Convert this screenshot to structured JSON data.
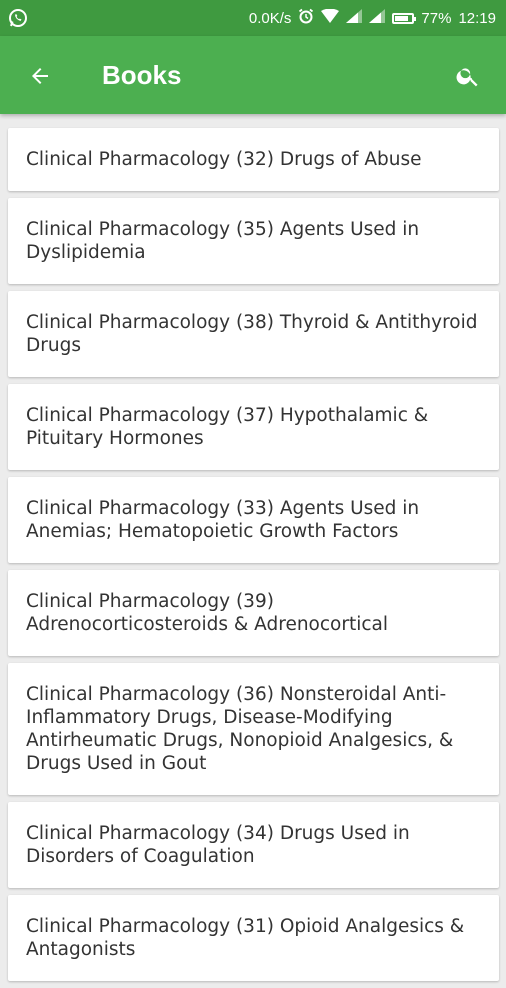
{
  "status_bar": {
    "network_speed": "0.0K/s",
    "battery_percent": "77%",
    "time": "12:19",
    "icons": [
      "whatsapp-icon",
      "alarm-icon",
      "wifi-icon",
      "signal-icon",
      "signal-icon",
      "battery-icon"
    ]
  },
  "app_bar": {
    "title": "Books",
    "back_icon": "arrow-back-icon",
    "search_icon": "search-icon",
    "background_color": "#4caf50",
    "status_color": "#3f9a40"
  },
  "books": [
    {
      "title": "Clinical Pharmacology (32) Drugs of Abuse"
    },
    {
      "title": "Clinical Pharmacology (35) Agents Used in Dyslipidemia"
    },
    {
      "title": "Clinical Pharmacology (38) Thyroid & Antithyroid Drugs"
    },
    {
      "title": "Clinical Pharmacology (37) Hypothalamic & Pituitary Hormones"
    },
    {
      "title": "Clinical Pharmacology (33) Agents Used in Anemias; Hematopoietic Growth Factors"
    },
    {
      "title": "Clinical Pharmacology (39) Adrenocorticosteroids & Adrenocortical"
    },
    {
      "title": "Clinical Pharmacology (36) Nonsteroidal Anti-Inflammatory Drugs, Disease-Modifying Antirheumatic Drugs, Nonopioid Analgesics, & Drugs Used in Gout"
    },
    {
      "title": "Clinical Pharmacology (34) Drugs Used in Disorders of Coagulation"
    },
    {
      "title": "Clinical Pharmacology (31) Opioid Analgesics & Antagonists"
    }
  ]
}
